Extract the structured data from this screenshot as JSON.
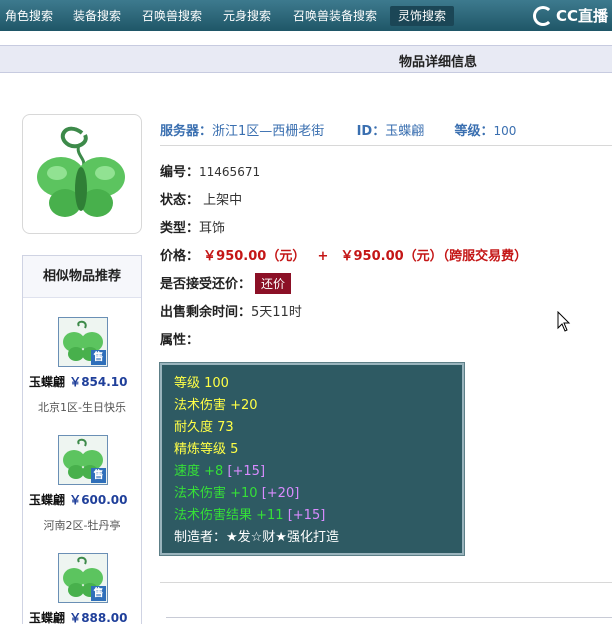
{
  "nav": {
    "tabs": [
      "角色搜索",
      "装备搜索",
      "召唤兽搜索",
      "元身搜索",
      "召唤兽装备搜索",
      "灵饰搜索"
    ],
    "active_index": 5,
    "logo_text": "CC直播"
  },
  "section_title": "物品详细信息",
  "item": {
    "server_label": "服务器：",
    "server_value": "浙江1区—西栅老街",
    "id_label": "ID：",
    "id_value": "玉蝶翩",
    "level_label": "等级：",
    "level_value": "100",
    "serial_label": "编号：",
    "serial_value": "11465671",
    "status_label": "状态：",
    "status_value": "上架中",
    "type_label": "类型：",
    "type_value": "耳饰",
    "price_label": "价格：",
    "price_value": "￥950.00（元）",
    "plus": "+",
    "fee_value": "￥950.00（元）（跨服交易费）",
    "haggle_label": "是否接受还价：",
    "haggle_button": "还价",
    "time_label": "出售剩余时间：",
    "time_value": "5天11时",
    "attr_label": "属性："
  },
  "attributes": [
    {
      "text": "等级 100",
      "color": "yellow"
    },
    {
      "text": "法术伤害 +20",
      "color": "yellow"
    },
    {
      "text": "耐久度 73",
      "color": "yellow"
    },
    {
      "text": "精炼等级 5",
      "color": "yellow"
    },
    {
      "text": "速度 +8",
      "extra": "[+15]",
      "color": "green"
    },
    {
      "text": "法术伤害 +10",
      "extra": "[+20]",
      "color": "green"
    },
    {
      "text": "法术伤害结果 +11",
      "extra": "[+15]",
      "color": "green"
    },
    {
      "text": "制造者：★发☆财★强化打造",
      "color": "white"
    }
  ],
  "similar": {
    "title": "相似物品推荐",
    "sold_badge": "售",
    "items": [
      {
        "name": "玉蝶翩",
        "price": "￥854.10",
        "server": "北京1区-生日快乐"
      },
      {
        "name": "玉蝶翩",
        "price": "￥600.00",
        "server": "河南2区-牡丹亭"
      },
      {
        "name": "玉蝶翩",
        "price": "￥888.00",
        "server": ""
      }
    ]
  }
}
